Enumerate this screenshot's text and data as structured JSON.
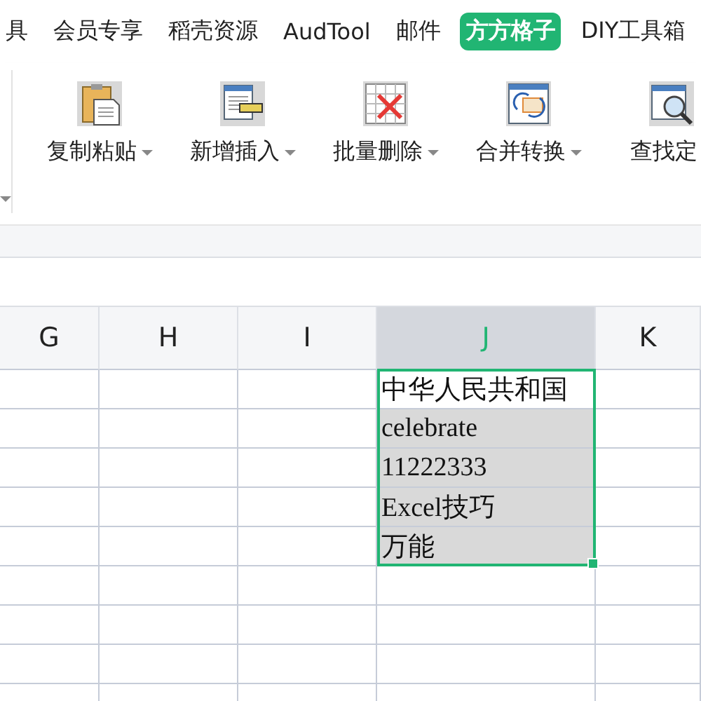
{
  "menu_tabs": [
    {
      "label": "具",
      "selected": false
    },
    {
      "label": "会员专享",
      "selected": false
    },
    {
      "label": "稻壳资源",
      "selected": false
    },
    {
      "label": "AudTool",
      "selected": false
    },
    {
      "label": "邮件",
      "selected": false
    },
    {
      "label": "方方格子",
      "selected": true
    },
    {
      "label": "DIY工具箱",
      "selected": false
    }
  ],
  "toolbar": [
    {
      "kind": "paste",
      "label": "复制粘贴"
    },
    {
      "kind": "insert",
      "label": "新增插入"
    },
    {
      "kind": "delete",
      "label": "批量删除"
    },
    {
      "kind": "convert",
      "label": "合并转换"
    },
    {
      "kind": "find",
      "label": "查找定"
    }
  ],
  "columns": [
    {
      "label": "G",
      "selected": false
    },
    {
      "label": "H",
      "selected": false
    },
    {
      "label": "I",
      "selected": false
    },
    {
      "label": "J",
      "selected": true
    },
    {
      "label": "K",
      "selected": false
    }
  ],
  "column_j_cells": [
    {
      "text": "中华人民共和国",
      "active": true,
      "selected": true
    },
    {
      "text": "celebrate",
      "active": false,
      "selected": true
    },
    {
      "text": "11222333",
      "active": false,
      "selected": true
    },
    {
      "text": "Excel技巧",
      "active": false,
      "selected": true
    },
    {
      "text": "万能",
      "active": false,
      "selected": true
    }
  ]
}
